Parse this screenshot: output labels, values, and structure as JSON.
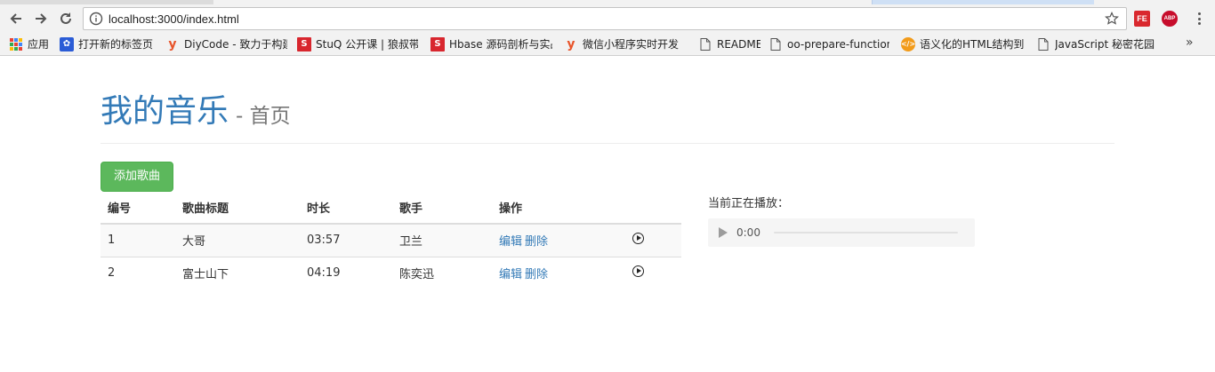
{
  "browser": {
    "url": "localhost:3000/index.html",
    "extensions": {
      "fe": "FE",
      "abp": "ABP"
    }
  },
  "bookmarks": [
    {
      "label": "应用",
      "icon": "apps-grid-icon"
    },
    {
      "label": "打开新的标签页",
      "icon": "paw-icon"
    },
    {
      "label": "DiyCode - 致力于构建",
      "icon": "y-logo-icon"
    },
    {
      "label": "StuQ 公开课 | 狼叔带",
      "icon": "s-logo-icon"
    },
    {
      "label": "Hbase 源码剖析与实战",
      "icon": "s-logo-icon"
    },
    {
      "label": "微信小程序实时开发",
      "icon": "y-logo-icon"
    },
    {
      "label": "README",
      "icon": "document-icon"
    },
    {
      "label": "oo-prepare-function-",
      "icon": "document-icon"
    },
    {
      "label": "语义化的HTML结构到",
      "icon": "code-icon"
    },
    {
      "label": "JavaScript 秘密花园",
      "icon": "document-icon"
    }
  ],
  "bookmarks_more": "»",
  "page": {
    "title": "我的音乐",
    "subtitle": "- 首页",
    "add_button": "添加歌曲",
    "table": {
      "headers": [
        "编号",
        "歌曲标题",
        "时长",
        "歌手",
        "操作"
      ],
      "rows": [
        {
          "id": "1",
          "title": "大哥",
          "duration": "03:57",
          "singer": "卫兰",
          "edit": "编辑",
          "delete": "删除"
        },
        {
          "id": "2",
          "title": "富士山下",
          "duration": "04:19",
          "singer": "陈奕迅",
          "edit": "编辑",
          "delete": "删除"
        }
      ]
    },
    "now_playing_label": "当前正在播放：",
    "player": {
      "time": "0:00"
    }
  },
  "colors": {
    "title": "#337ab7",
    "link": "#337ab7",
    "add_button": "#5cb85c"
  }
}
